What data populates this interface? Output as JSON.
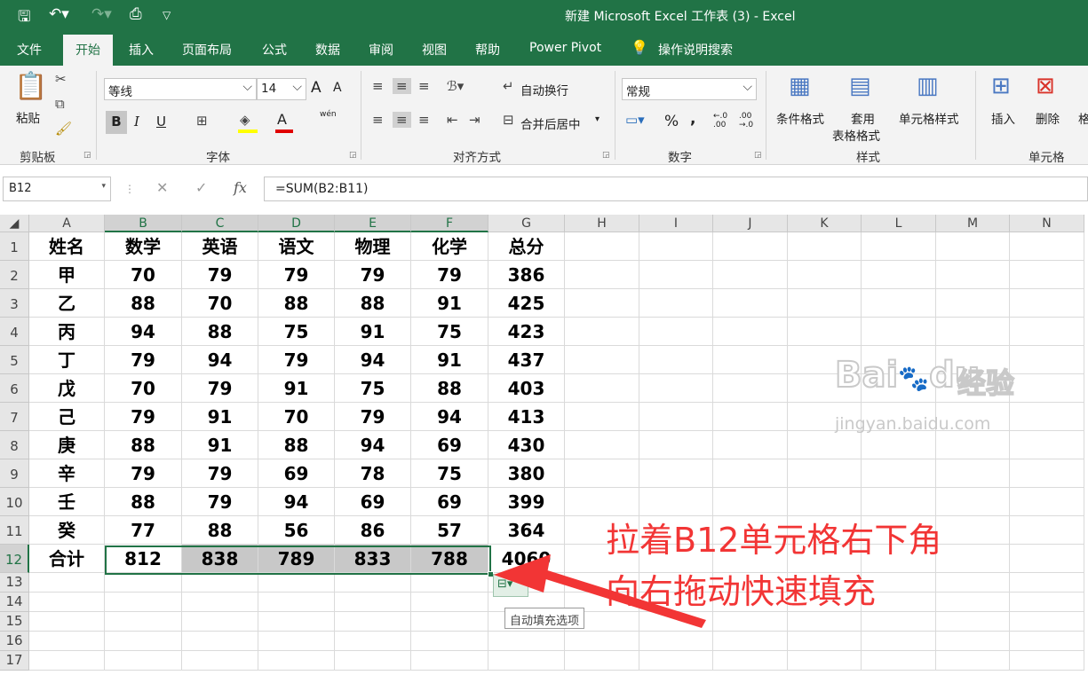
{
  "window": {
    "title": "新建 Microsoft Excel 工作表 (3)  -  Excel"
  },
  "quick_access": {
    "icons": [
      "save-icon",
      "undo-icon",
      "redo-icon",
      "print-preview-icon",
      "customize-icon"
    ]
  },
  "tabs": [
    "文件",
    "开始",
    "插入",
    "页面布局",
    "公式",
    "数据",
    "审阅",
    "视图",
    "帮助",
    "Power Pivot"
  ],
  "active_tab": "开始",
  "tell_me": "操作说明搜索",
  "ribbon": {
    "clipboard": {
      "paste": "粘贴",
      "group": "剪贴板"
    },
    "font": {
      "name": "等线",
      "size": "14",
      "bold": "B",
      "italic": "I",
      "underline": "U",
      "grow": "A",
      "shrink": "A",
      "phonetic": "wén",
      "group": "字体"
    },
    "alignment": {
      "wrap": "自动换行",
      "merge": "合并后居中",
      "group": "对齐方式"
    },
    "number": {
      "format": "常规",
      "percent": "%",
      "comma": ",",
      "group": "数字"
    },
    "styles": {
      "conditional": "条件格式",
      "table_1": "套用",
      "table_2": "表格格式",
      "cell_styles": "单元格样式",
      "group": "样式"
    },
    "cells": {
      "insert": "插入",
      "delete": "删除",
      "format": "格",
      "group": "单元格"
    }
  },
  "formula_bar": {
    "name_box": "B12",
    "cancel": "✕",
    "enter": "✓",
    "fx": "fx",
    "formula": "=SUM(B2:B11)"
  },
  "sheet": {
    "columns": [
      "A",
      "B",
      "C",
      "D",
      "E",
      "F",
      "G",
      "H",
      "I",
      "J",
      "K",
      "L",
      "M",
      "N"
    ],
    "rows": [
      [
        "姓名",
        "数学",
        "英语",
        "语文",
        "物理",
        "化学",
        "总分"
      ],
      [
        "甲",
        "70",
        "79",
        "79",
        "79",
        "79",
        "386"
      ],
      [
        "乙",
        "88",
        "70",
        "88",
        "88",
        "91",
        "425"
      ],
      [
        "丙",
        "94",
        "88",
        "75",
        "91",
        "75",
        "423"
      ],
      [
        "丁",
        "79",
        "94",
        "79",
        "94",
        "91",
        "437"
      ],
      [
        "戊",
        "70",
        "79",
        "91",
        "75",
        "88",
        "403"
      ],
      [
        "己",
        "79",
        "91",
        "70",
        "79",
        "94",
        "413"
      ],
      [
        "庚",
        "88",
        "91",
        "88",
        "94",
        "69",
        "430"
      ],
      [
        "辛",
        "79",
        "79",
        "69",
        "78",
        "75",
        "380"
      ],
      [
        "壬",
        "88",
        "79",
        "94",
        "69",
        "69",
        "399"
      ],
      [
        "癸",
        "77",
        "88",
        "56",
        "86",
        "57",
        "364"
      ],
      [
        "合计",
        "812",
        "838",
        "789",
        "833",
        "788",
        "4060"
      ],
      [],
      [],
      [],
      [],
      []
    ]
  },
  "autofill": {
    "tooltip": "自动填充选项"
  },
  "annotation": {
    "line1": "拉着B12单元格右下角",
    "line2": "向右拖动快速填充",
    "color": "#f23535"
  },
  "watermark": {
    "brand": "Bai",
    "brand2": "du",
    "suffix": "经验",
    "url": "jingyan.baidu.com"
  },
  "colors": {
    "excel_green": "#217346",
    "ribbon_bg": "#f3f3f3",
    "header_bg": "#e6e6e6",
    "fill_highlight": "#c8c8c8"
  }
}
